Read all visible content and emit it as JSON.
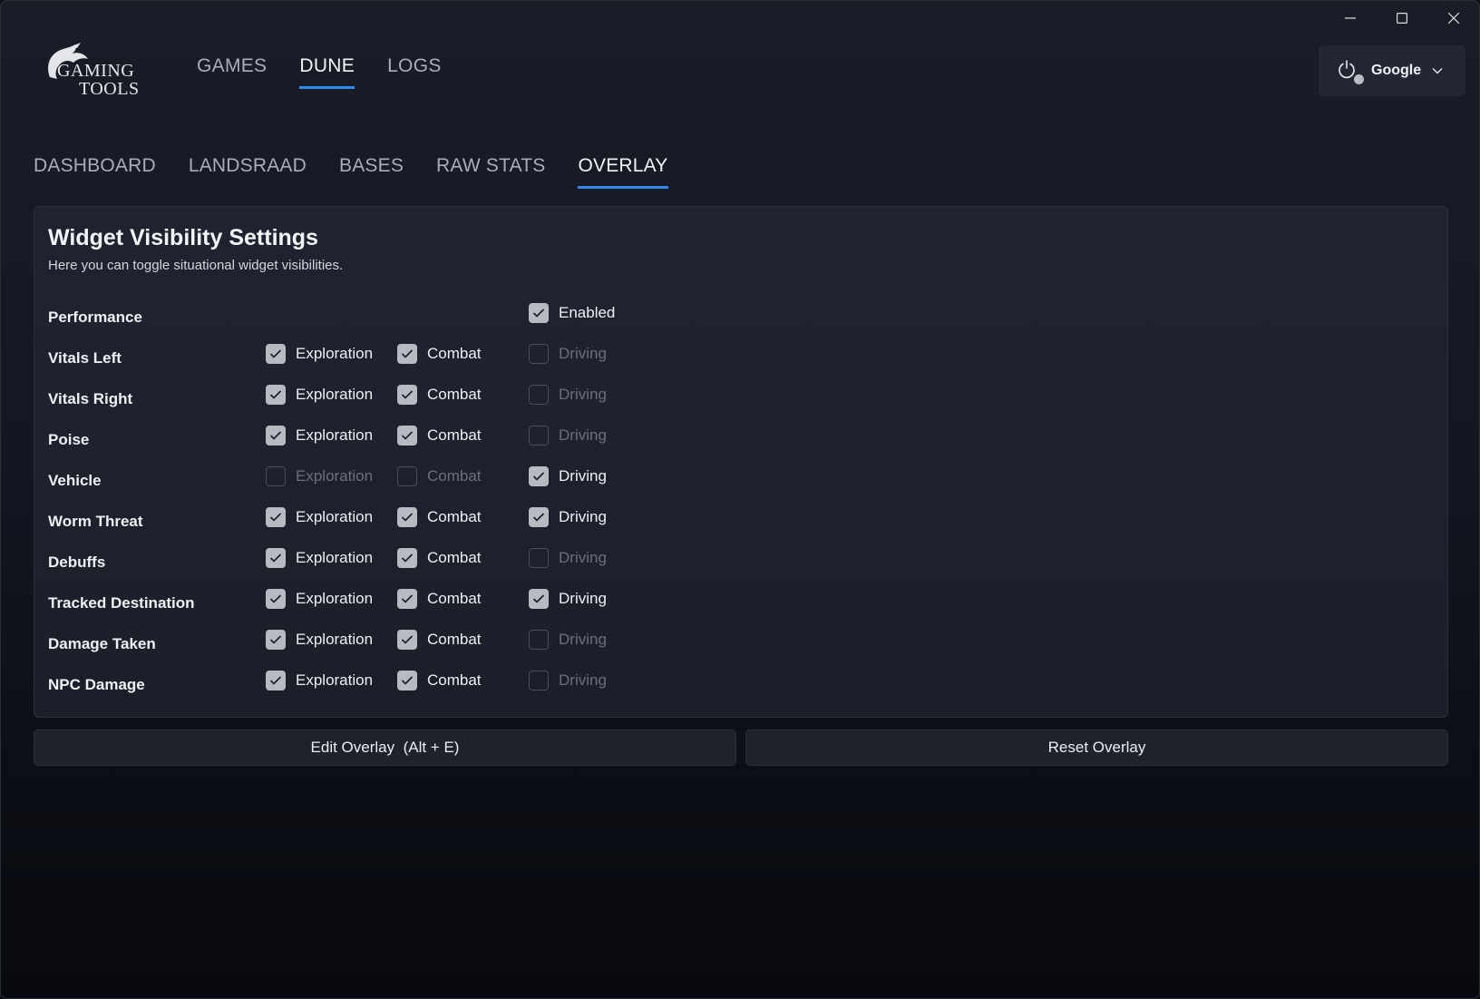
{
  "logo": {
    "line1": "GAMING",
    "line2": "TOOLS"
  },
  "top_nav": [
    {
      "label": "GAMES",
      "active": false
    },
    {
      "label": "DUNE",
      "active": true
    },
    {
      "label": "LOGS",
      "active": false
    }
  ],
  "account": {
    "label": "Google",
    "icon": "power-icon"
  },
  "sub_nav": [
    {
      "label": "DASHBOARD",
      "active": false
    },
    {
      "label": "LANDSRAAD",
      "active": false
    },
    {
      "label": "BASES",
      "active": false
    },
    {
      "label": "RAW STATS",
      "active": false
    },
    {
      "label": "OVERLAY",
      "active": true
    }
  ],
  "panel": {
    "title": "Widget Visibility Settings",
    "subtitle": "Here you can toggle situational widget visibilities."
  },
  "widgets": [
    {
      "label": "Performance",
      "options": [
        null,
        null,
        {
          "label": "Enabled",
          "checked": true
        }
      ]
    },
    {
      "label": "Vitals Left",
      "options": [
        {
          "label": "Exploration",
          "checked": true
        },
        {
          "label": "Combat",
          "checked": true
        },
        {
          "label": "Driving",
          "checked": false
        }
      ]
    },
    {
      "label": "Vitals Right",
      "options": [
        {
          "label": "Exploration",
          "checked": true
        },
        {
          "label": "Combat",
          "checked": true
        },
        {
          "label": "Driving",
          "checked": false
        }
      ]
    },
    {
      "label": "Poise",
      "options": [
        {
          "label": "Exploration",
          "checked": true
        },
        {
          "label": "Combat",
          "checked": true
        },
        {
          "label": "Driving",
          "checked": false
        }
      ]
    },
    {
      "label": "Vehicle",
      "options": [
        {
          "label": "Exploration",
          "checked": false
        },
        {
          "label": "Combat",
          "checked": false
        },
        {
          "label": "Driving",
          "checked": true
        }
      ]
    },
    {
      "label": "Worm Threat",
      "options": [
        {
          "label": "Exploration",
          "checked": true
        },
        {
          "label": "Combat",
          "checked": true
        },
        {
          "label": "Driving",
          "checked": true
        }
      ]
    },
    {
      "label": "Debuffs",
      "options": [
        {
          "label": "Exploration",
          "checked": true
        },
        {
          "label": "Combat",
          "checked": true
        },
        {
          "label": "Driving",
          "checked": false
        }
      ]
    },
    {
      "label": "Tracked Destination",
      "options": [
        {
          "label": "Exploration",
          "checked": true
        },
        {
          "label": "Combat",
          "checked": true
        },
        {
          "label": "Driving",
          "checked": true
        }
      ]
    },
    {
      "label": "Damage Taken",
      "options": [
        {
          "label": "Exploration",
          "checked": true
        },
        {
          "label": "Combat",
          "checked": true
        },
        {
          "label": "Driving",
          "checked": false
        }
      ]
    },
    {
      "label": "NPC Damage",
      "options": [
        {
          "label": "Exploration",
          "checked": true
        },
        {
          "label": "Combat",
          "checked": true
        },
        {
          "label": "Driving",
          "checked": false
        }
      ]
    }
  ],
  "buttons": {
    "edit_label": "Edit Overlay  (Alt + E)",
    "reset_label": "Reset Overlay"
  },
  "colors": {
    "accent": "#2d8cf0",
    "checked_box": "#b7bac0"
  }
}
